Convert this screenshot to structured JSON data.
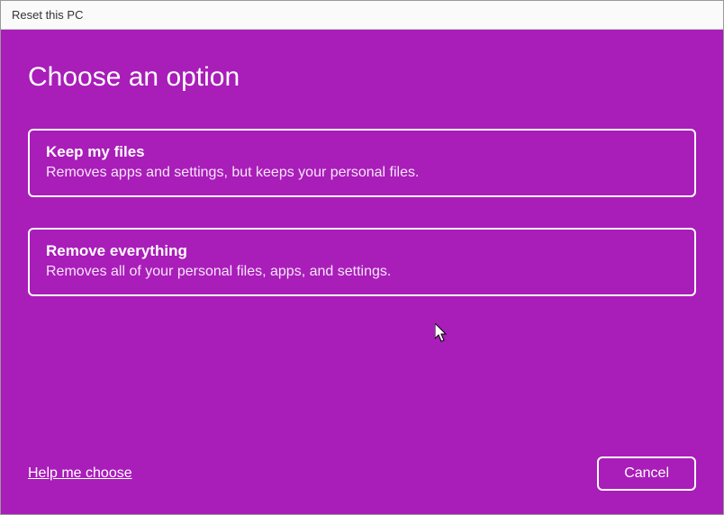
{
  "window": {
    "title": "Reset this PC"
  },
  "heading": "Choose an option",
  "options": [
    {
      "title": "Keep my files",
      "description": "Removes apps and settings, but keeps your personal files."
    },
    {
      "title": "Remove everything",
      "description": "Removes all of your personal files, apps, and settings."
    }
  ],
  "help_link": "Help me choose",
  "cancel_label": "Cancel",
  "colors": {
    "accent": "#a91db9"
  }
}
